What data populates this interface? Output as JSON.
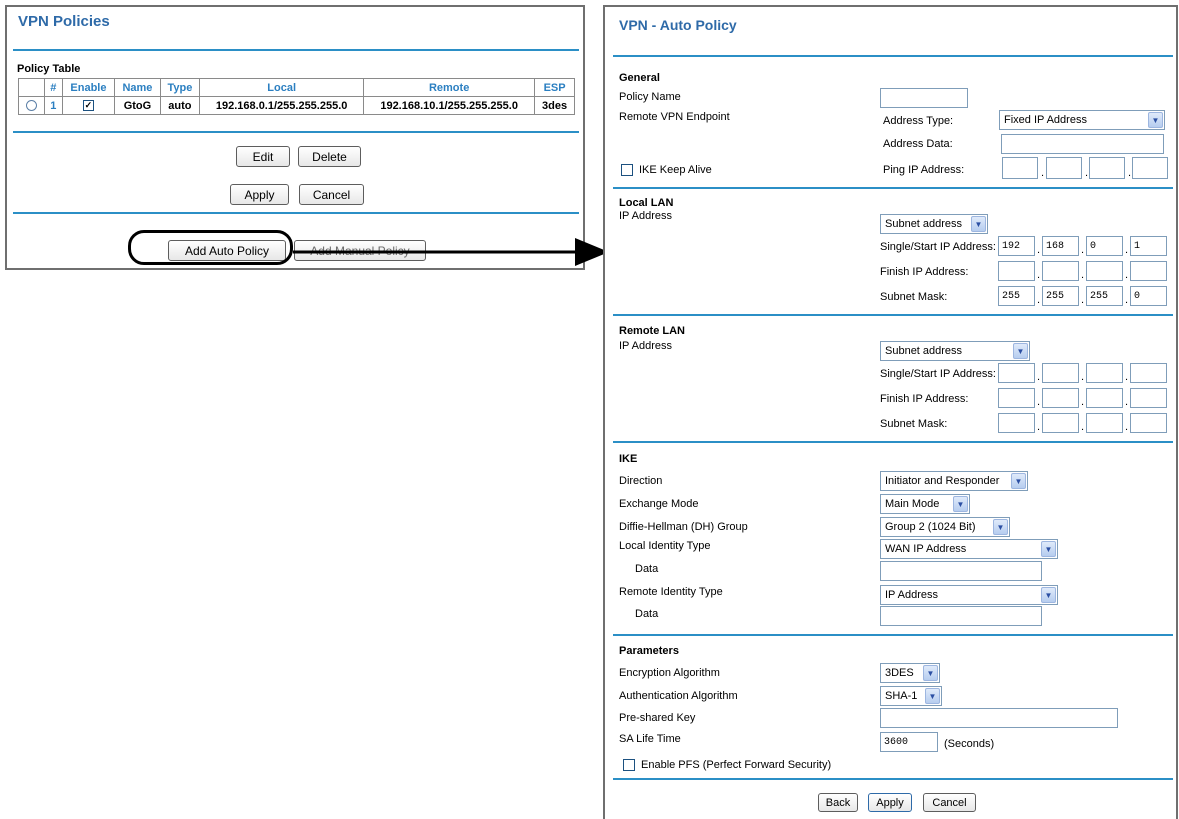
{
  "vpn_policies": {
    "title": "VPN Policies",
    "policy_table_label": "Policy Table",
    "columns": [
      "#",
      "Enable",
      "Name",
      "Type",
      "Local",
      "Remote",
      "ESP"
    ],
    "row": {
      "num": "1",
      "name": "GtoG",
      "type": "auto",
      "local": "192.168.0.1/255.255.255.0",
      "remote": "192.168.10.1/255.255.255.0",
      "esp": "3des"
    },
    "buttons": {
      "edit": "Edit",
      "delete": "Delete",
      "apply": "Apply",
      "cancel": "Cancel",
      "add_auto": "Add Auto Policy",
      "add_manual": "Add Manual Policy"
    }
  },
  "auto_policy": {
    "title": "VPN - Auto Policy",
    "general": {
      "heading": "General",
      "policy_name_label": "Policy Name",
      "policy_name_value": "",
      "remote_endpoint_label": "Remote VPN Endpoint",
      "address_type_label": "Address Type:",
      "address_type_value": "Fixed IP Address",
      "address_data_label": "Address Data:",
      "ike_keep_alive_label": "IKE Keep Alive",
      "ping_ip_label": "Ping IP Address:"
    },
    "local_lan": {
      "heading": "Local LAN",
      "ip_address_label": "IP Address",
      "type_value": "Subnet address",
      "start_ip_label": "Single/Start IP Address:",
      "start_ip": [
        "192",
        "168",
        "0",
        "1"
      ],
      "finish_ip_label": "Finish IP Address:",
      "subnet_mask_label": "Subnet Mask:",
      "subnet_mask": [
        "255",
        "255",
        "255",
        "0"
      ]
    },
    "remote_lan": {
      "heading": "Remote LAN",
      "ip_address_label": "IP Address",
      "type_value": "Subnet address",
      "start_ip_label": "Single/Start IP Address:",
      "finish_ip_label": "Finish IP Address:",
      "subnet_mask_label": "Subnet Mask:"
    },
    "ike": {
      "heading": "IKE",
      "direction_label": "Direction",
      "direction_value": "Initiator and Responder",
      "exchange_label": "Exchange Mode",
      "exchange_value": "Main Mode",
      "dh_label": "Diffie-Hellman (DH) Group",
      "dh_value": "Group 2 (1024 Bit)",
      "local_id_label": "Local Identity Type",
      "local_id_value": "WAN IP Address",
      "data_label": "Data",
      "remote_id_label": "Remote Identity Type",
      "remote_id_value": "IP Address"
    },
    "parameters": {
      "heading": "Parameters",
      "enc_label": "Encryption Algorithm",
      "enc_value": "3DES",
      "auth_label": "Authentication Algorithm",
      "auth_value": "SHA-1",
      "psk_label": "Pre-shared Key",
      "sa_life_label": "SA Life Time",
      "sa_life_value": "3600",
      "seconds_label": "(Seconds)",
      "pfs_label": "Enable PFS (Perfect Forward Security)"
    },
    "buttons": {
      "back": "Back",
      "apply": "Apply",
      "cancel": "Cancel"
    }
  },
  "icons": {
    "dropdown": "chevron-down-icon",
    "check": "check-icon",
    "radio": "radio-icon"
  },
  "colors": {
    "title": "#2e6aa8",
    "rule": "#2b8fc6",
    "header_text": "#2b7fc1"
  }
}
